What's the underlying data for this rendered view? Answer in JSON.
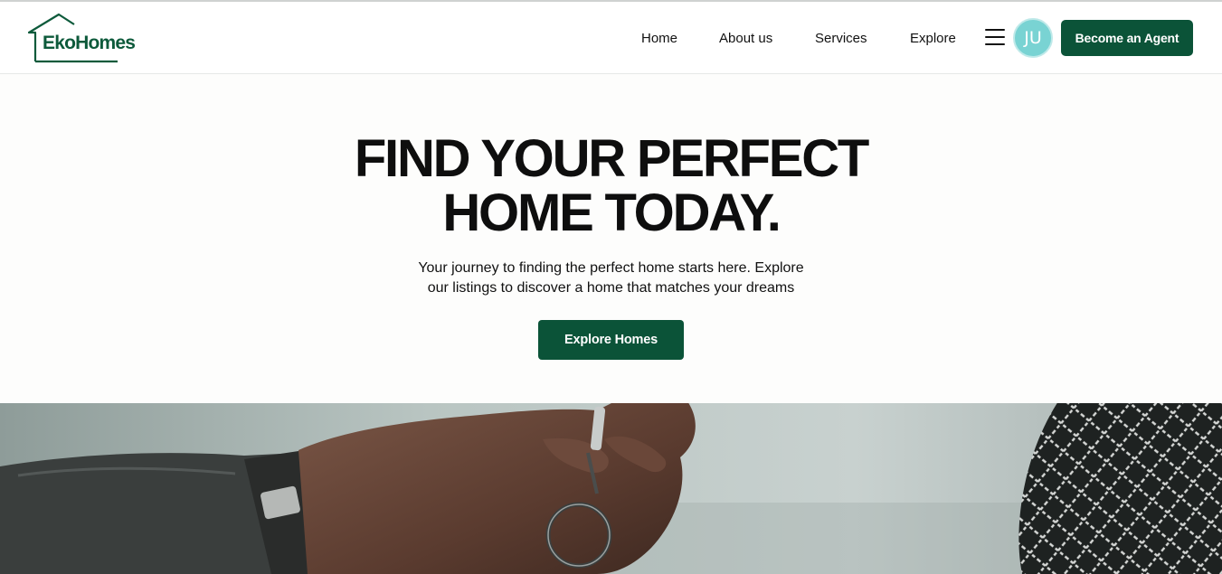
{
  "header": {
    "logo_text": "EkoHomes",
    "nav": [
      {
        "label": "Home"
      },
      {
        "label": "About us"
      },
      {
        "label": "Services"
      },
      {
        "label": "Explore"
      }
    ],
    "menu_icon": "hamburger-menu-icon",
    "avatar_initials": "JU",
    "agent_button_label": "Become an Agent"
  },
  "hero": {
    "title_line1": "FIND YOUR PERFECT",
    "title_line2": "HOME TODAY.",
    "subtitle_line1": "Your journey to finding the perfect home starts here. Explore",
    "subtitle_line2": "our listings to discover a home that matches your dreams",
    "cta_label": "Explore Homes"
  },
  "colors": {
    "brand_green": "#0b5338",
    "avatar_bg": "#79d3d3",
    "page_bg": "#fdfdfc"
  }
}
